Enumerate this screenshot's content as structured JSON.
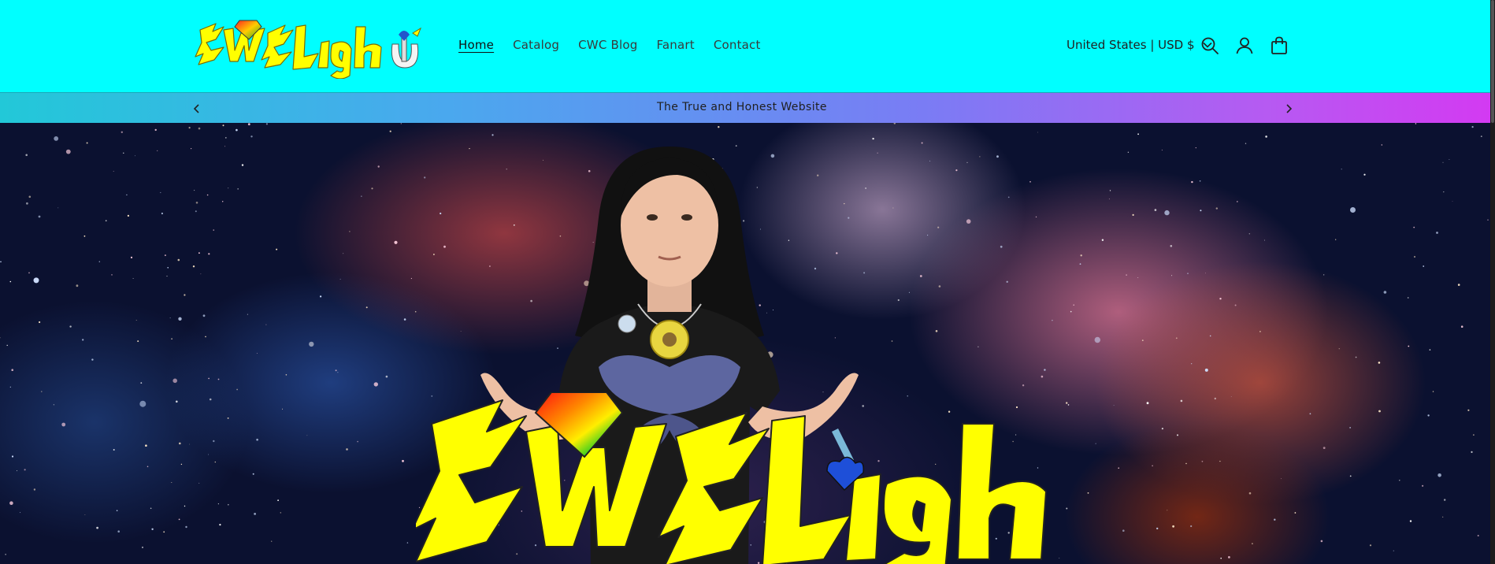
{
  "header": {
    "logo_alt": "CWCLight",
    "nav": [
      {
        "label": "Home",
        "active": true
      },
      {
        "label": "Catalog",
        "active": false
      },
      {
        "label": "CWC Blog",
        "active": false
      },
      {
        "label": "Fanart",
        "active": false
      },
      {
        "label": "Contact",
        "active": false
      }
    ],
    "country_selector": "United States | USD $",
    "icons": [
      "search-icon",
      "account-icon",
      "cart-icon"
    ]
  },
  "announcement": {
    "message": "The True and Honest Website",
    "prev_icon": "chevron-left-icon",
    "next_icon": "chevron-right-icon"
  },
  "hero": {
    "logo_alt": "CWCLight"
  },
  "colors": {
    "header_bg": "#00ffff",
    "logo_yellow": "#ffff00",
    "announce_gradient_start": "#22c8d8",
    "announce_gradient_end": "#d33af2"
  }
}
